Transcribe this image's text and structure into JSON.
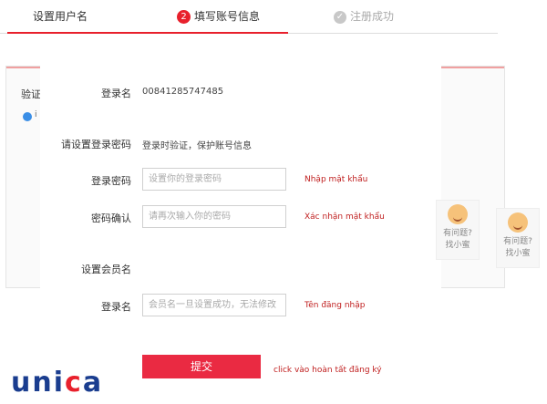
{
  "steps": [
    {
      "label": "设置用户名"
    },
    {
      "num": "2",
      "label": "填写账号信息"
    },
    {
      "label": "注册成功"
    }
  ],
  "background": {
    "title_partial": "验证",
    "info_partial": "i"
  },
  "form": {
    "login_name_label": "登录名",
    "login_name_value": "00841285747485",
    "password_section_label": "请设置登录密码",
    "password_section_desc": "登录时验证，保护账号信息",
    "password_label": "登录密码",
    "password_placeholder": "设置你的登录密码",
    "password_hint": "Nhập mật khẩu",
    "confirm_label": "密码确认",
    "confirm_placeholder": "请再次输入你的密码",
    "confirm_hint": "Xác nhận mật khẩu",
    "member_section_label": "设置会员名",
    "member_label": "登录名",
    "member_placeholder": "会员名一旦设置成功，无法修改",
    "member_hint": "Tên đăng nhập",
    "submit_label": "提交",
    "submit_hint": "click vào hoàn tất đăng ký"
  },
  "help": [
    {
      "line1": "有问题?",
      "line2": "找小蜜"
    },
    {
      "line1": "有问题?",
      "line2": "找小蜜"
    }
  ],
  "logo": {
    "part1": "un",
    "part2": "i",
    "part3": "c",
    "part4": "a"
  },
  "colors": {
    "accent": "#e8202c",
    "submit": "#ea2a42",
    "hint": "#c02020",
    "logo_blue": "#1a3d8f"
  }
}
